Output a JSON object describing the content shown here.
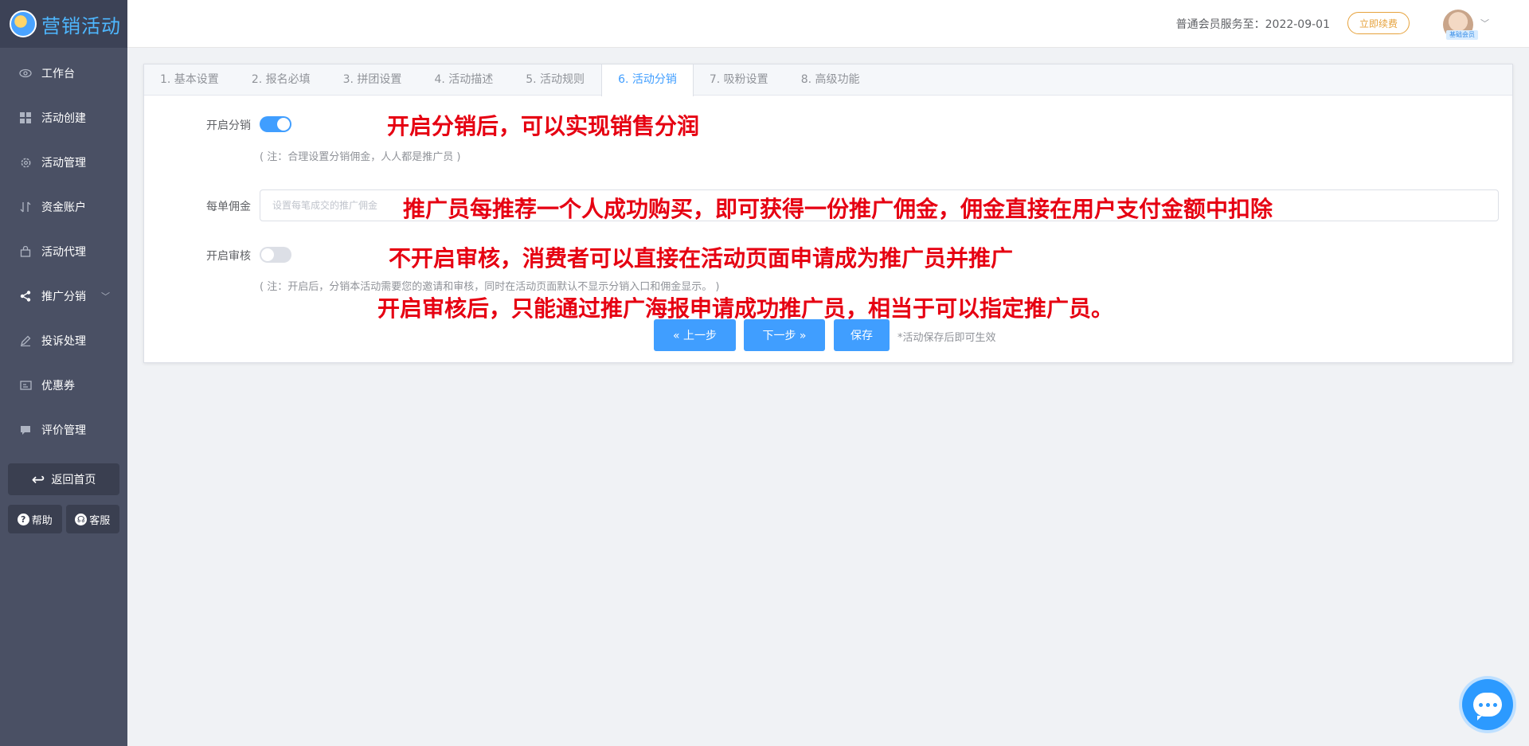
{
  "brand": {
    "title": "营销活动"
  },
  "sidebar": {
    "items": [
      {
        "label": "工作台",
        "icon": "eye-icon"
      },
      {
        "label": "活动创建",
        "icon": "grid-icon"
      },
      {
        "label": "活动管理",
        "icon": "gear-icon"
      },
      {
        "label": "资金账户",
        "icon": "transfer-icon"
      },
      {
        "label": "活动代理",
        "icon": "bag-icon"
      },
      {
        "label": "推广分销",
        "icon": "share-icon",
        "active": true
      },
      {
        "label": "投诉处理",
        "icon": "edit-icon"
      },
      {
        "label": "优惠券",
        "icon": "coupon-icon"
      },
      {
        "label": "评价管理",
        "icon": "comment-icon"
      }
    ],
    "back_label": "返回首页",
    "help_label": "帮助",
    "service_label": "客服"
  },
  "header": {
    "service_text": "普通会员服务至：2022-09-01",
    "renew_label": "立即续费",
    "member_badge": "基础会员"
  },
  "tabs": [
    {
      "label": "1. 基本设置"
    },
    {
      "label": "2. 报名必填"
    },
    {
      "label": "3. 拼团设置"
    },
    {
      "label": "4. 活动描述"
    },
    {
      "label": "5. 活动规则"
    },
    {
      "label": "6. 活动分销",
      "active": true
    },
    {
      "label": "7. 吸粉设置"
    },
    {
      "label": "8. 高级功能"
    }
  ],
  "form": {
    "distribution_label": "开启分销",
    "distribution_on": true,
    "distribution_note": "( 注：合理设置分销佣金，人人都是推广员 )",
    "commission_label": "每单佣金",
    "commission_placeholder": "设置每笔成交的推广佣金",
    "audit_label": "开启审核",
    "audit_on": false,
    "audit_note": "( 注：开启后，分销本活动需要您的邀请和审核，同时在活动页面默认不显示分销入口和佣金显示。 )"
  },
  "annotations": {
    "a1": "开启分销后，可以实现销售分润",
    "a2": "推广员每推荐一个人成功购买，即可获得一份推广佣金，佣金直接在用户支付金额中扣除",
    "a3": "不开启审核，消费者可以直接在活动页面申请成为推广员并推广",
    "a4": "开启审核后，只能通过推广海报申请成功推广员，相当于可以指定推广员。"
  },
  "actions": {
    "prev_label": "« 上一步",
    "next_label": "下一步 »",
    "save_label": "保存",
    "save_hint": "*活动保存后即可生效"
  },
  "colors": {
    "primary": "#409eff",
    "annotation": "#e60012",
    "sidebar": "#4a5064"
  }
}
